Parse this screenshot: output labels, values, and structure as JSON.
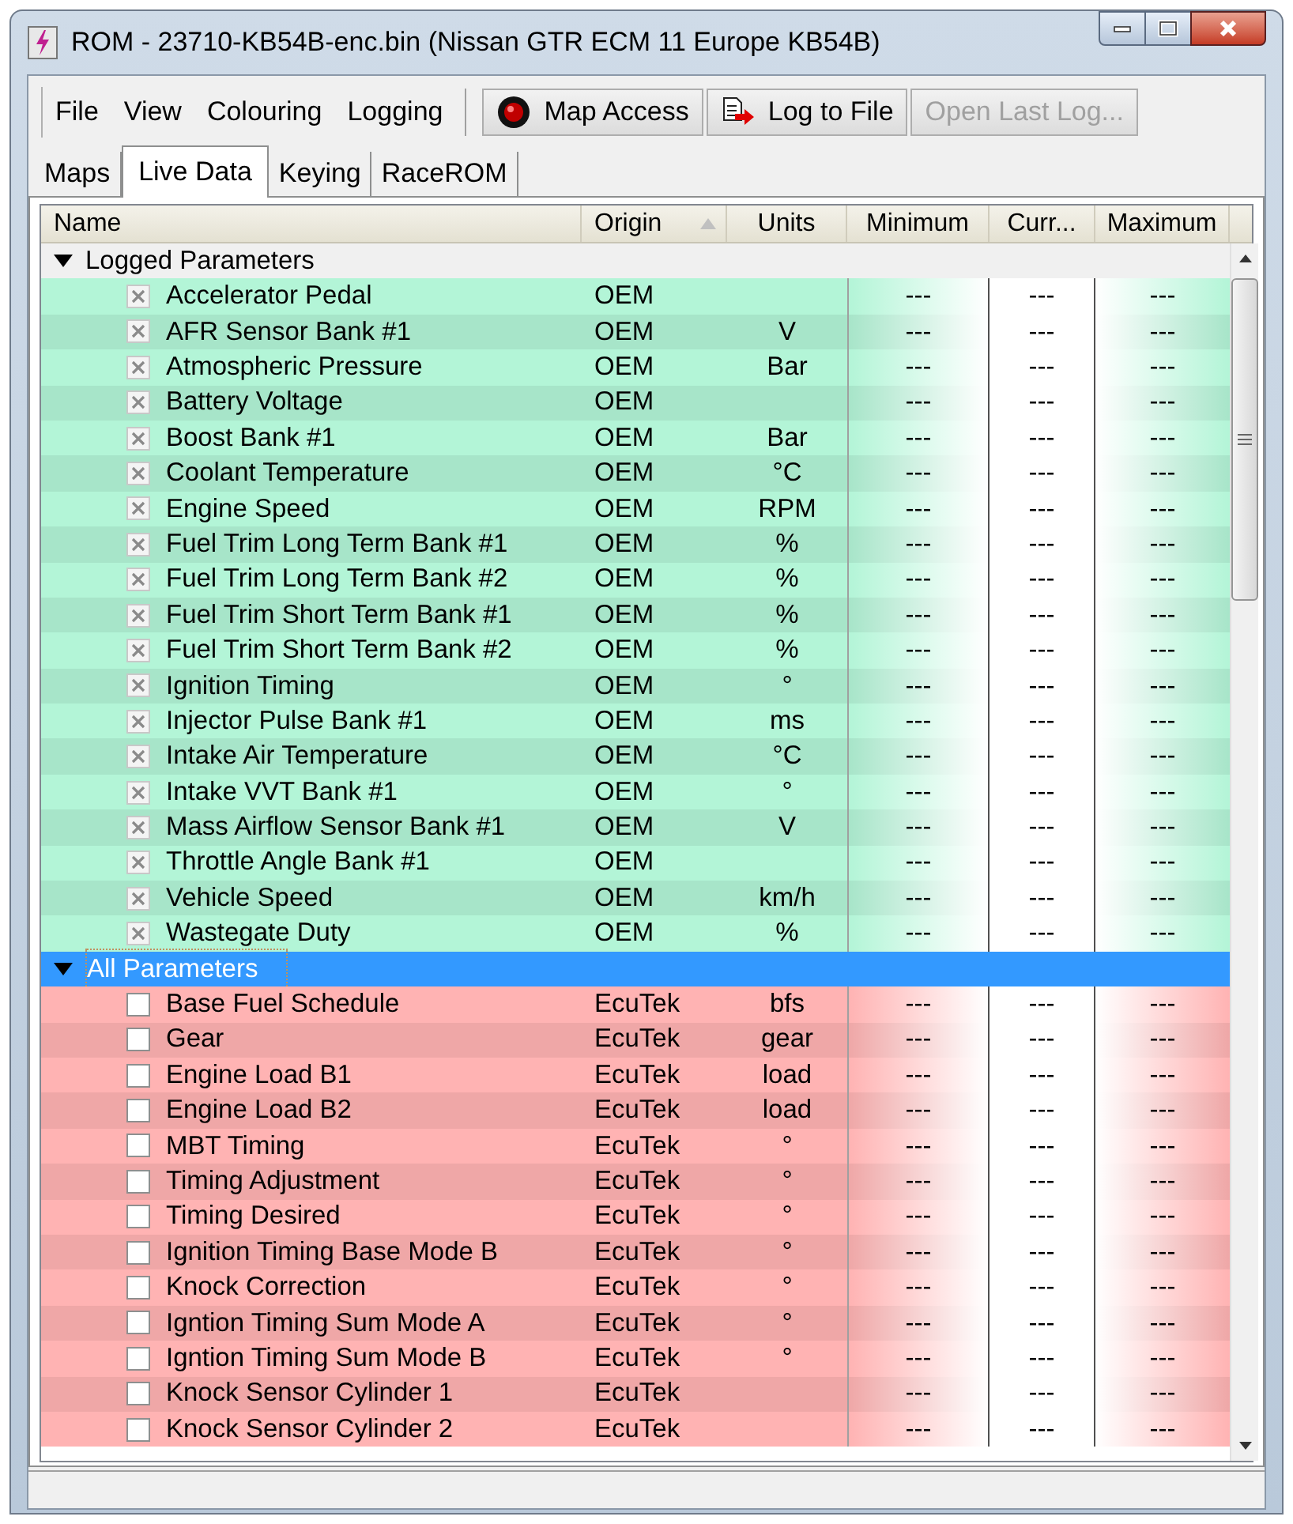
{
  "window": {
    "title": "ROM - 23710-KB54B-enc.bin (Nissan GTR ECM 11 Europe KB54B)"
  },
  "menu": [
    "File",
    "View",
    "Colouring",
    "Logging"
  ],
  "toolbar": [
    {
      "kind": "record",
      "label": "Map Access",
      "disabled": false
    },
    {
      "kind": "log",
      "label": "Log to File",
      "disabled": false
    },
    {
      "kind": "plain",
      "label": "Open Last Log...",
      "disabled": true
    }
  ],
  "tabs": [
    {
      "label": "Maps",
      "selected": false
    },
    {
      "label": "Live Data",
      "selected": true
    },
    {
      "label": "Keying",
      "selected": false
    },
    {
      "label": "RaceROM",
      "selected": false
    }
  ],
  "columns": [
    "Name",
    "Origin",
    "Units",
    "Minimum",
    "Curr...",
    "Maximum"
  ],
  "groups": [
    {
      "label": "Logged Parameters",
      "expanded": true,
      "selected": false,
      "color": "#b3f5d7",
      "items": [
        {
          "name": "Accelerator Pedal",
          "origin": "OEM",
          "minimum": "---",
          "current": "---",
          "maximum": "---",
          "checked": true
        },
        {
          "name": "AFR Sensor Bank #1",
          "origin": "OEM",
          "units": "V",
          "minimum": "---",
          "current": "---",
          "maximum": "---",
          "checked": true
        },
        {
          "name": "Atmospheric Pressure",
          "origin": "OEM",
          "units": "Bar",
          "minimum": "---",
          "current": "---",
          "maximum": "---",
          "checked": true
        },
        {
          "name": "Battery Voltage",
          "origin": "OEM",
          "minimum": "---",
          "current": "---",
          "maximum": "---",
          "checked": true
        },
        {
          "name": "Boost Bank #1",
          "origin": "OEM",
          "units": "Bar",
          "minimum": "---",
          "current": "---",
          "maximum": "---",
          "checked": true
        },
        {
          "name": "Coolant Temperature",
          "origin": "OEM",
          "units": "°C",
          "minimum": "---",
          "current": "---",
          "maximum": "---",
          "checked": true
        },
        {
          "name": "Engine Speed",
          "origin": "OEM",
          "units": "RPM",
          "minimum": "---",
          "current": "---",
          "maximum": "---",
          "checked": true
        },
        {
          "name": "Fuel Trim Long Term Bank #1",
          "origin": "OEM",
          "units": "%",
          "minimum": "---",
          "current": "---",
          "maximum": "---",
          "checked": true
        },
        {
          "name": "Fuel Trim Long Term Bank #2",
          "origin": "OEM",
          "units": "%",
          "minimum": "---",
          "current": "---",
          "maximum": "---",
          "checked": true
        },
        {
          "name": "Fuel Trim Short Term Bank #1",
          "origin": "OEM",
          "units": "%",
          "minimum": "---",
          "current": "---",
          "maximum": "---",
          "checked": true
        },
        {
          "name": "Fuel Trim Short Term Bank #2",
          "origin": "OEM",
          "units": "%",
          "minimum": "---",
          "current": "---",
          "maximum": "---",
          "checked": true
        },
        {
          "name": "Ignition Timing",
          "origin": "OEM",
          "units": "°",
          "minimum": "---",
          "current": "---",
          "maximum": "---",
          "checked": true
        },
        {
          "name": "Injector Pulse Bank #1",
          "origin": "OEM",
          "units": "ms",
          "minimum": "---",
          "current": "---",
          "maximum": "---",
          "checked": true
        },
        {
          "name": "Intake Air Temperature",
          "origin": "OEM",
          "units": "°C",
          "minimum": "---",
          "current": "---",
          "maximum": "---",
          "checked": true
        },
        {
          "name": "Intake VVT Bank #1",
          "origin": "OEM",
          "units": "°",
          "minimum": "---",
          "current": "---",
          "maximum": "---",
          "checked": true
        },
        {
          "name": "Mass Airflow Sensor Bank #1",
          "origin": "OEM",
          "units": "V",
          "minimum": "---",
          "current": "---",
          "maximum": "---",
          "checked": true
        },
        {
          "name": "Throttle Angle Bank #1",
          "origin": "OEM",
          "minimum": "---",
          "current": "---",
          "maximum": "---",
          "checked": true
        },
        {
          "name": "Vehicle Speed",
          "origin": "OEM",
          "units": "km/h",
          "minimum": "---",
          "current": "---",
          "maximum": "---",
          "checked": true
        },
        {
          "name": "Wastegate Duty",
          "origin": "OEM",
          "units": "%",
          "minimum": "---",
          "current": "---",
          "maximum": "---",
          "checked": true
        }
      ]
    },
    {
      "label": "All Parameters",
      "expanded": true,
      "selected": true,
      "color": "#ffb3b3",
      "items": [
        {
          "name": "Base Fuel Schedule",
          "origin": "EcuTek",
          "units": "bfs",
          "minimum": "---",
          "current": "---",
          "maximum": "---",
          "checked": false
        },
        {
          "name": "Gear",
          "origin": "EcuTek",
          "units": "gear",
          "minimum": "---",
          "current": "---",
          "maximum": "---",
          "checked": false
        },
        {
          "name": "Engine Load B1",
          "origin": "EcuTek",
          "units": "load",
          "minimum": "---",
          "current": "---",
          "maximum": "---",
          "checked": false
        },
        {
          "name": "Engine Load B2",
          "origin": "EcuTek",
          "units": "load",
          "minimum": "---",
          "current": "---",
          "maximum": "---",
          "checked": false
        },
        {
          "name": "MBT Timing",
          "origin": "EcuTek",
          "units": "°",
          "minimum": "---",
          "current": "---",
          "maximum": "---",
          "checked": false
        },
        {
          "name": "Timing Adjustment",
          "origin": "EcuTek",
          "units": "°",
          "minimum": "---",
          "current": "---",
          "maximum": "---",
          "checked": false
        },
        {
          "name": "Timing Desired",
          "origin": "EcuTek",
          "units": "°",
          "minimum": "---",
          "current": "---",
          "maximum": "---",
          "checked": false
        },
        {
          "name": "Ignition Timing Base Mode B",
          "origin": "EcuTek",
          "units": "°",
          "minimum": "---",
          "current": "---",
          "maximum": "---",
          "checked": false
        },
        {
          "name": "Knock Correction",
          "origin": "EcuTek",
          "units": "°",
          "minimum": "---",
          "current": "---",
          "maximum": "---",
          "checked": false
        },
        {
          "name": "Igntion Timing Sum Mode A",
          "origin": "EcuTek",
          "units": "°",
          "minimum": "---",
          "current": "---",
          "maximum": "---",
          "checked": false
        },
        {
          "name": "Igntion Timing Sum Mode B",
          "origin": "EcuTek",
          "units": "°",
          "minimum": "---",
          "current": "---",
          "maximum": "---",
          "checked": false
        },
        {
          "name": "Knock Sensor Cylinder 1",
          "origin": "EcuTek",
          "minimum": "---",
          "current": "---",
          "maximum": "---",
          "checked": false
        },
        {
          "name": "Knock Sensor Cylinder 2",
          "origin": "EcuTek",
          "minimum": "---",
          "current": "---",
          "maximum": "---",
          "checked": false
        }
      ]
    }
  ]
}
